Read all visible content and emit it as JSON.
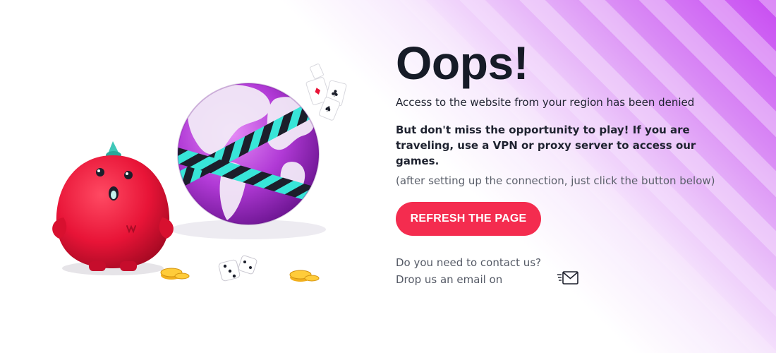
{
  "page": {
    "title": "Oops!",
    "message_region": "Access to the website from your region has been denied",
    "message_play": "But don't miss the opportunity to play! If you are traveling, use a VPN or proxy server to access our games.",
    "message_hint": "(after setting up the connection, just click the button below)"
  },
  "actions": {
    "refresh_label": "REFRESH THE PAGE"
  },
  "contact": {
    "question": "Do you need to contact us?",
    "drop_email": "Drop us an email on"
  },
  "icons": {
    "mail": "envelope-icon",
    "character": "red-monster-mascot",
    "globe": "restricted-globe",
    "dice": "dice-icon",
    "coins": "coins-icon",
    "cards": "playing-cards-icon"
  },
  "colors": {
    "accent": "#f42c4f",
    "gradient_purple": "#c84cf2",
    "title": "#161b27"
  }
}
